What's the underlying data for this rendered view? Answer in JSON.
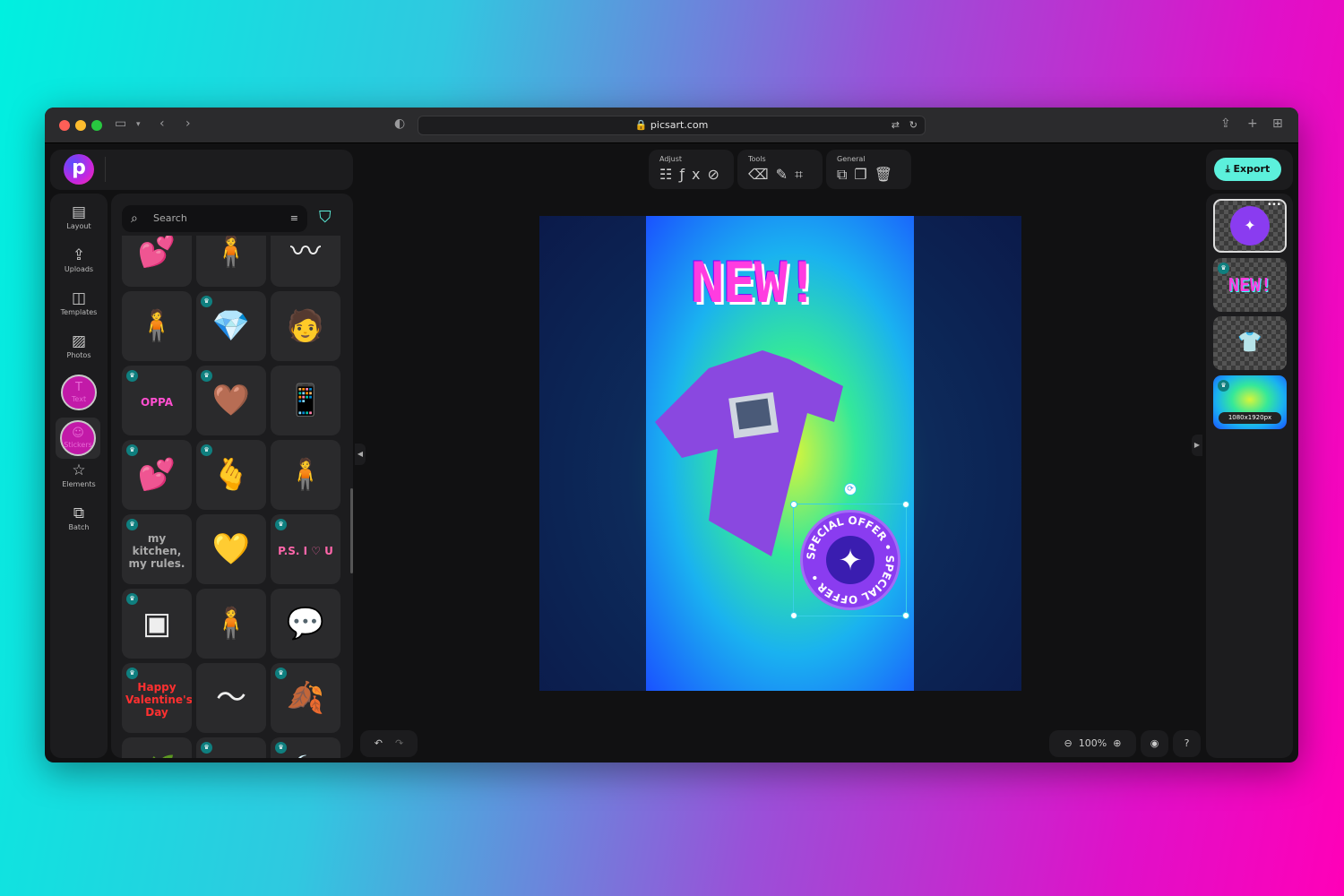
{
  "browser": {
    "url": "picsart.com",
    "icons": [
      "sidebar-icon",
      "chevron-down-icon",
      "back-icon",
      "forward-icon",
      "shield-icon",
      "translate-icon",
      "reload-icon",
      "share-icon",
      "new-tab-icon",
      "tabs-grid-icon"
    ]
  },
  "app": {
    "logo": "p"
  },
  "nav": [
    {
      "label": "Layout",
      "icon": "▤"
    },
    {
      "label": "Uploads",
      "icon": "⇪"
    },
    {
      "label": "Templates",
      "icon": "◫"
    },
    {
      "label": "Photos",
      "icon": "▨"
    },
    {
      "label": "Text",
      "icon": "T"
    },
    {
      "label": "Stickers",
      "icon": "☺"
    },
    {
      "label": "Elements",
      "icon": "☆"
    },
    {
      "label": "Batch",
      "icon": "⧉"
    }
  ],
  "search": {
    "placeholder": "Search"
  },
  "stickers": [
    {
      "g": "💕",
      "p": false
    },
    {
      "g": "🧍",
      "p": false
    },
    {
      "g": "〰",
      "p": false
    },
    {
      "g": "🧍",
      "p": false
    },
    {
      "g": "💎",
      "p": true
    },
    {
      "g": "🧑",
      "p": false
    },
    {
      "g": "OPPA",
      "p": true
    },
    {
      "g": "🤎",
      "p": true
    },
    {
      "g": "📱",
      "p": false
    },
    {
      "g": "💕",
      "p": true
    },
    {
      "g": "🫰",
      "p": true
    },
    {
      "g": "🧍",
      "p": false
    },
    {
      "g": "my kitchen, my rules.",
      "p": true
    },
    {
      "g": "💛",
      "p": false
    },
    {
      "g": "P.S. I ♡ U",
      "p": true
    },
    {
      "g": "▣",
      "p": true
    },
    {
      "g": "🧍",
      "p": false
    },
    {
      "g": "💬",
      "p": false
    },
    {
      "g": "Happy Valentine's Day",
      "p": true
    },
    {
      "g": "〜",
      "p": false
    },
    {
      "g": "🍂",
      "p": true
    },
    {
      "g": "🌿",
      "p": false
    },
    {
      "g": "▢",
      "p": true
    },
    {
      "g": "🍃",
      "p": true
    }
  ],
  "toolbar": {
    "groups": [
      {
        "label": "Adjust",
        "icons": "☷ƒx⊘"
      },
      {
        "label": "Tools",
        "icons": "⌫✎⌗"
      },
      {
        "label": "General",
        "icons": "⧉❐🗑"
      }
    ]
  },
  "canvas": {
    "headline": "NEW!",
    "badge_text": "SPECIAL OFFER • SPECIAL OFFER •",
    "badge_icon": "✦"
  },
  "export_label": "Export",
  "layers": [
    {
      "name": "special-offer-badge",
      "selected": true
    },
    {
      "name": "new-text",
      "premium": true
    },
    {
      "name": "tshirt"
    },
    {
      "name": "background",
      "size": "1080x1920px",
      "premium": true
    }
  ],
  "zoom": {
    "level": "100%"
  },
  "colors": {
    "accent": "#5cf0dc",
    "selection": "#39d0e6",
    "active_nav": "#c21aa8"
  }
}
